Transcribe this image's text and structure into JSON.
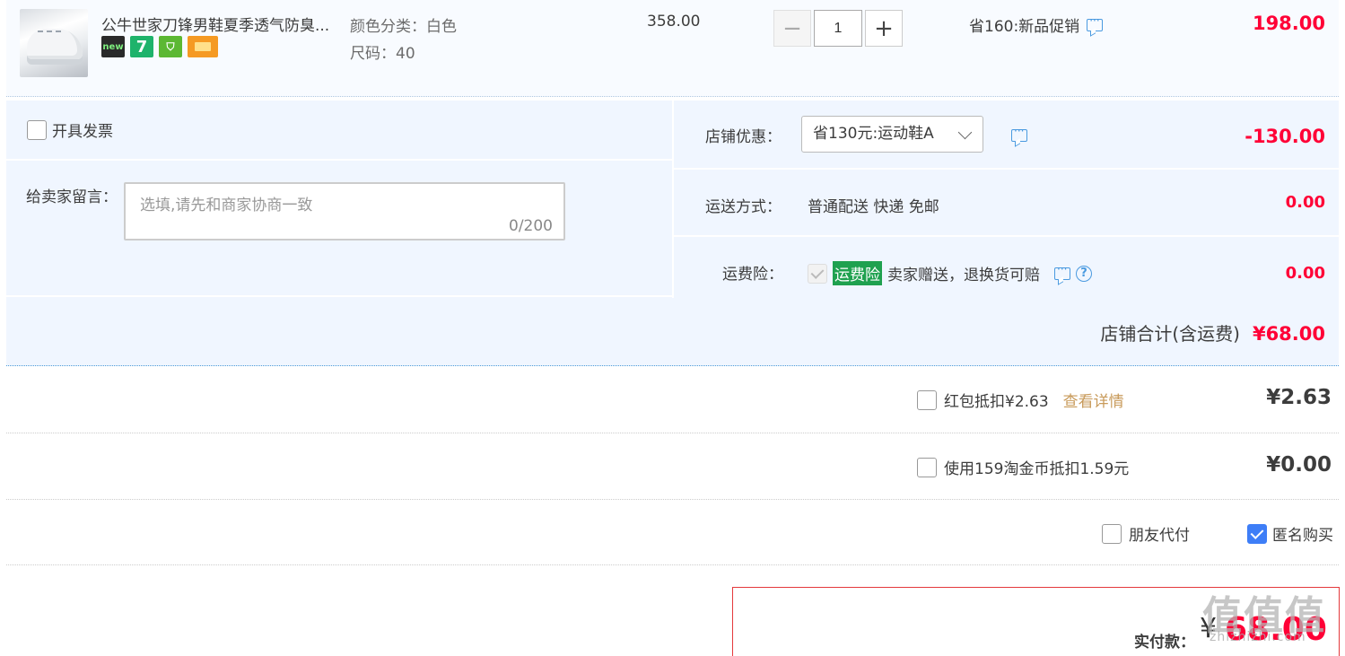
{
  "product": {
    "title": "公牛世家刀锋男鞋夏季透气防臭...",
    "sku_color": "颜色分类：白色",
    "sku_size": "尺码：40",
    "price": "358.00",
    "quantity": "1",
    "promo": "省160:新品促销",
    "total": "198.00",
    "badges": [
      "new",
      "7",
      "green-badge",
      "card-badge"
    ]
  },
  "invoice": {
    "label": "开具发票"
  },
  "message": {
    "label": "给卖家留言：",
    "placeholder": "选填,请先和商家协商一致",
    "count": "0/200"
  },
  "shop_discount": {
    "label": "店铺优惠：",
    "selected": "省130元:运动鞋A",
    "amount": "-130.00"
  },
  "shipping": {
    "label": "运送方式：",
    "value": "普通配送 快递 免邮",
    "amount": "0.00"
  },
  "insurance": {
    "label": "运费险：",
    "tag": "运费险",
    "value": "卖家赠送，退换货可赔",
    "amount": "0.00"
  },
  "shop_total": {
    "label": "店铺合计(含运费)",
    "amount": "¥68.00"
  },
  "red_packet": {
    "label": "红包抵扣¥2.63",
    "link": "查看详情",
    "amount": "¥2.63"
  },
  "coins": {
    "label": "使用159淘金币抵扣1.59元",
    "amount": "¥0.00"
  },
  "friend_pay": {
    "label": "朋友代付"
  },
  "anonymous": {
    "label": "匿名购买",
    "checked": true
  },
  "final": {
    "label": "实付款：",
    "currency": "¥",
    "amount": "68.00"
  },
  "watermark": {
    "main": "值值值",
    "sub": "zhizhizhi.com"
  },
  "colors": {
    "accent_red": "#ff0036",
    "link_blue": "#4a9ae0",
    "insurance_green": "#1fa14f",
    "checkbox_blue": "#3e7ef7"
  }
}
